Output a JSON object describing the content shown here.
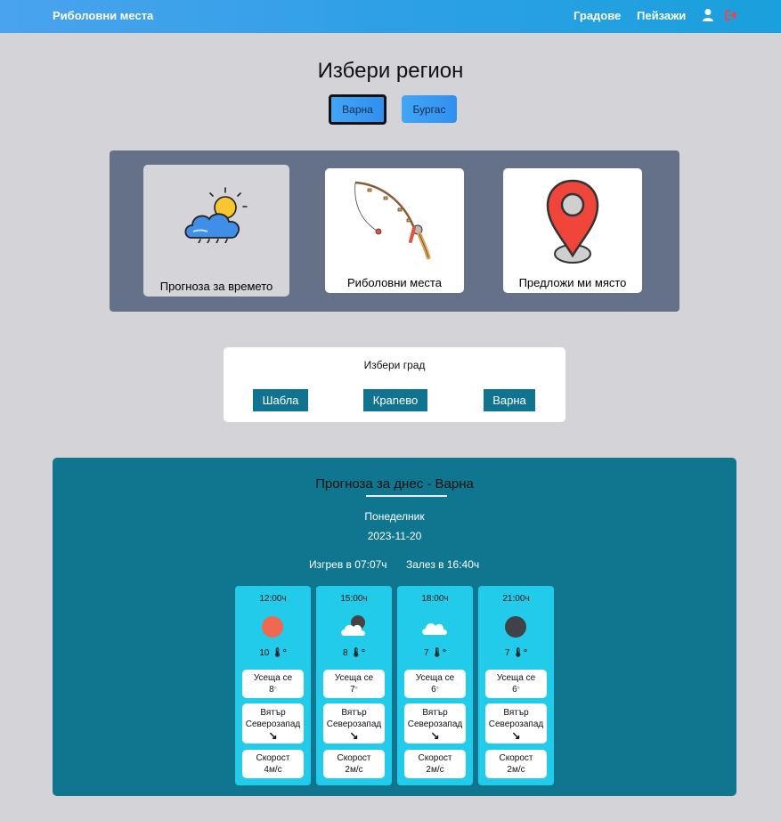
{
  "navbar": {
    "brand": "Риболовни места",
    "links": [
      "Градове",
      "Пейзажи"
    ],
    "icons": [
      "user-icon",
      "logout-icon"
    ]
  },
  "region": {
    "title": "Избери регион",
    "buttons": [
      {
        "label": "Варна",
        "active": true
      },
      {
        "label": "Бургас",
        "active": false
      }
    ]
  },
  "tiles": [
    {
      "label": "Прогноза за времето",
      "icon": "weather-icon",
      "selected": true
    },
    {
      "label": "Риболовни места",
      "icon": "fishing-rod-icon",
      "selected": false
    },
    {
      "label": "Предложи ми място",
      "icon": "map-pin-icon",
      "selected": false
    }
  ],
  "city": {
    "title": "Избери град",
    "buttons": [
      "Шабла",
      "Краnево",
      "Варна"
    ]
  },
  "forecast": {
    "title": "Прогноза за днес - Варна",
    "day": "Понеделник",
    "date": "2023-11-20",
    "sunrise": "Изгрев в 07:07ч",
    "sunset": "Залез в 16:40ч",
    "hours": [
      {
        "time": "12:00ч",
        "icon": "sun-icon",
        "temp": "10",
        "feels_label": "Усеща се",
        "feels": "8",
        "wind_label": "Вятър",
        "wind_dir": "Северозапад",
        "arrow": "↘",
        "speed_label": "Скорост",
        "speed": "4м/с"
      },
      {
        "time": "15:00ч",
        "icon": "cloud-moon-icon",
        "temp": "8",
        "feels_label": "Усеща се",
        "feels": "7",
        "wind_label": "Вятър",
        "wind_dir": "Северозапад",
        "arrow": "↘",
        "speed_label": "Скорост",
        "speed": "2м/с"
      },
      {
        "time": "18:00ч",
        "icon": "cloud-icon",
        "temp": "7",
        "feels_label": "Усеща се",
        "feels": "6",
        "wind_label": "Вятър",
        "wind_dir": "Северозапад",
        "arrow": "↘",
        "speed_label": "Скорост",
        "speed": "2м/с"
      },
      {
        "time": "21:00ч",
        "icon": "moon-icon",
        "temp": "7",
        "feels_label": "Усеща се",
        "feels": "6",
        "wind_label": "Вятър",
        "wind_dir": "Северозапад",
        "arrow": "↘",
        "speed_label": "Скорост",
        "speed": "2м/с"
      }
    ],
    "degree_symbol": "°",
    "thermo_symbol": "🌡"
  },
  "colors": {
    "navbar": "#2ea0e6",
    "background": "#d4d3d8",
    "panel": "#647189",
    "city_button": "#107490",
    "forecast": "#10768f",
    "hour_card": "#22cbe9"
  }
}
